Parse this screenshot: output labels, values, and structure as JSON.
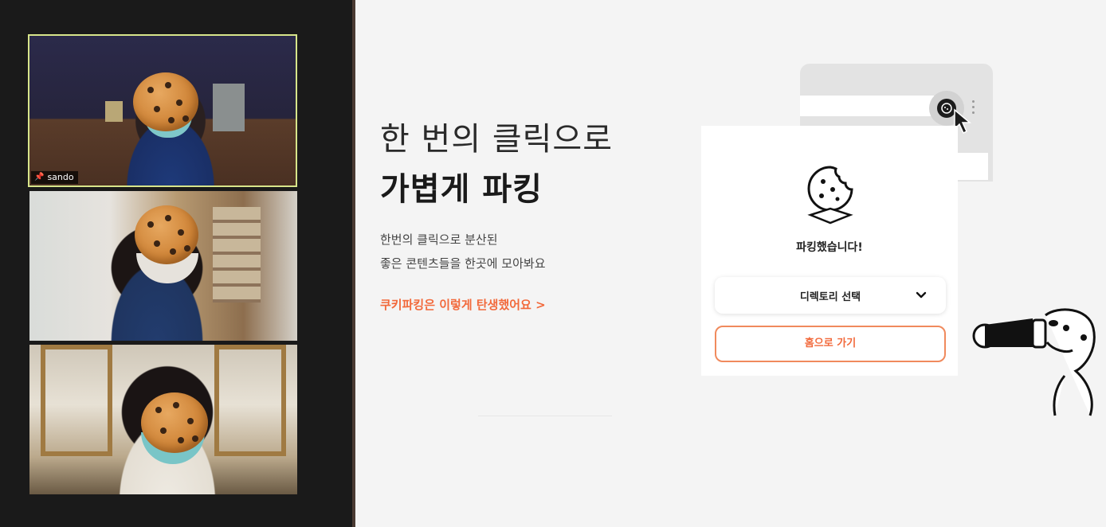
{
  "video_call": {
    "participants": [
      {
        "name": "sando",
        "pinned": true
      },
      {
        "name": ""
      },
      {
        "name": ""
      }
    ]
  },
  "hero": {
    "title_line1": "한 번의 클릭으로",
    "title_line2": "가볍게 파킹",
    "description_line1": "한번의 클릭으로 분산된",
    "description_line2": "좋은 콘텐츠들을 한곳에 모아봐요",
    "story_link": "쿠키파킹은 이렇게 탄생했어요  >"
  },
  "popup": {
    "status_text": "파킹했습니다!",
    "directory_select": "디렉토리 선택",
    "home_button": "홈으로 가기"
  },
  "icons": {
    "pin": "pin-icon",
    "cookie": "cookie-icon",
    "chevron": "chevron-down-icon",
    "cursor": "cursor-icon",
    "extension": "extension-icon",
    "kebab": "kebab-menu-icon"
  },
  "colors": {
    "accent": "#f2693b",
    "accent_border": "#f08a5d",
    "active_speaker_border": "#d7e58a",
    "panel_bg": "#1a1a1a",
    "page_bg": "#f4f4f4"
  }
}
